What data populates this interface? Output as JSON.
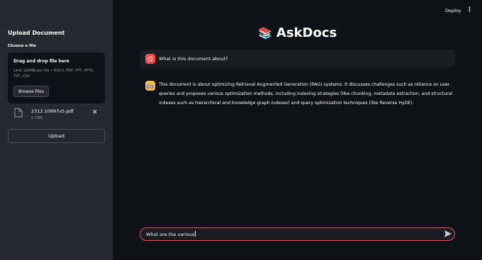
{
  "header": {
    "deploy_label": "Deploy",
    "menu_icon": "kebab-menu-icon"
  },
  "sidebar": {
    "title": "Upload Document",
    "choose_label": "Choose a file",
    "dropzone": {
      "title": "Drag and drop file here",
      "limit": "Limit 200MB per file • DOCX, PDF, PPT, PPTX, TXT, CSV",
      "browse_label": "Browse files"
    },
    "file": {
      "name": "2312.10997v5.pdf",
      "size": "1.7MB",
      "icon": "file-icon"
    },
    "upload_label": "Upload"
  },
  "main": {
    "title_icon": "📚",
    "title": "AskDocs",
    "messages": [
      {
        "role": "user",
        "text": "What is this document about?"
      },
      {
        "role": "assistant",
        "text": "This document is about optimizing Retrieval Augmented Generation (RAG) systems. It discusses challenges such as reliance on user queries and proposes various optimization methods, including indexing strategies (like chunking, metadata extraction, and structural indexes such as hierarchical and knowledge graph indexes) and query optimization techniques (like Reverse HyDE)."
      }
    ],
    "chat_input": {
      "value": "What are the various"
    }
  },
  "colors": {
    "accent": "#ff4b4b",
    "bot_avatar": "#ffbd45",
    "sidebar_bg": "#262730",
    "main_bg": "#0e1117"
  }
}
